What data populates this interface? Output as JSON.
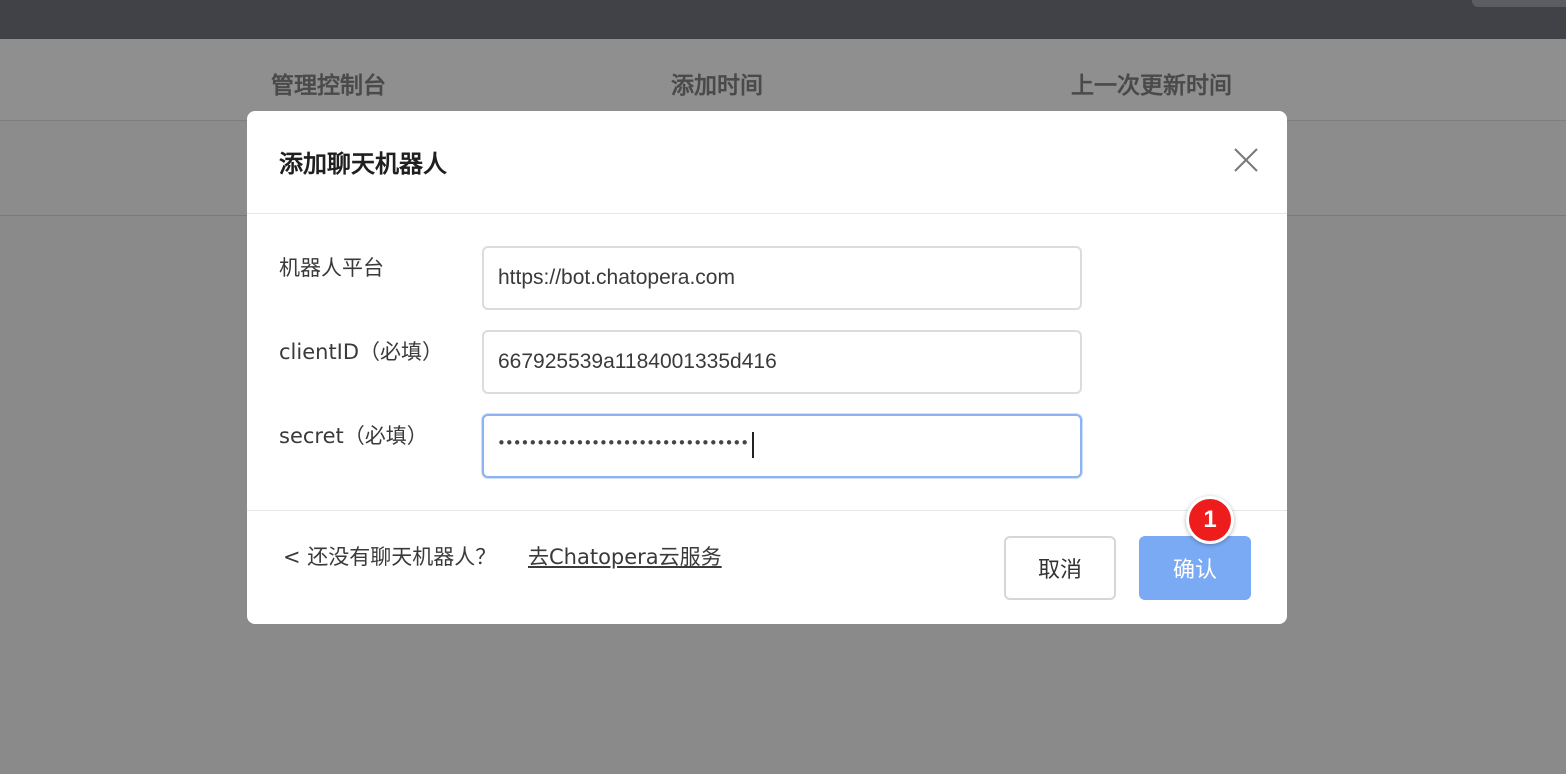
{
  "table": {
    "headers": [
      "管理控制台",
      "添加时间",
      "上一次更新时间"
    ]
  },
  "dialog": {
    "title": "添加聊天机器人",
    "fields": {
      "platform": {
        "label": "机器人平台",
        "value": "https://bot.chatopera.com"
      },
      "client_id": {
        "label": "clientID（必填）",
        "value": "667925539a1184001335d416"
      },
      "secret": {
        "label": "secret（必填）",
        "value_masked": "••••••••••••••••••••••••••••••••"
      }
    },
    "footer": {
      "hint": "< 还没有聊天机器人？",
      "link": "去Chatopera云服务"
    },
    "buttons": {
      "cancel": "取消",
      "confirm": "确认"
    }
  },
  "annotation": {
    "step_number": "1"
  },
  "colors": {
    "overlay": "#8a8a8a",
    "primary": "#7aaaf3",
    "badge": "#ee1c1c"
  }
}
